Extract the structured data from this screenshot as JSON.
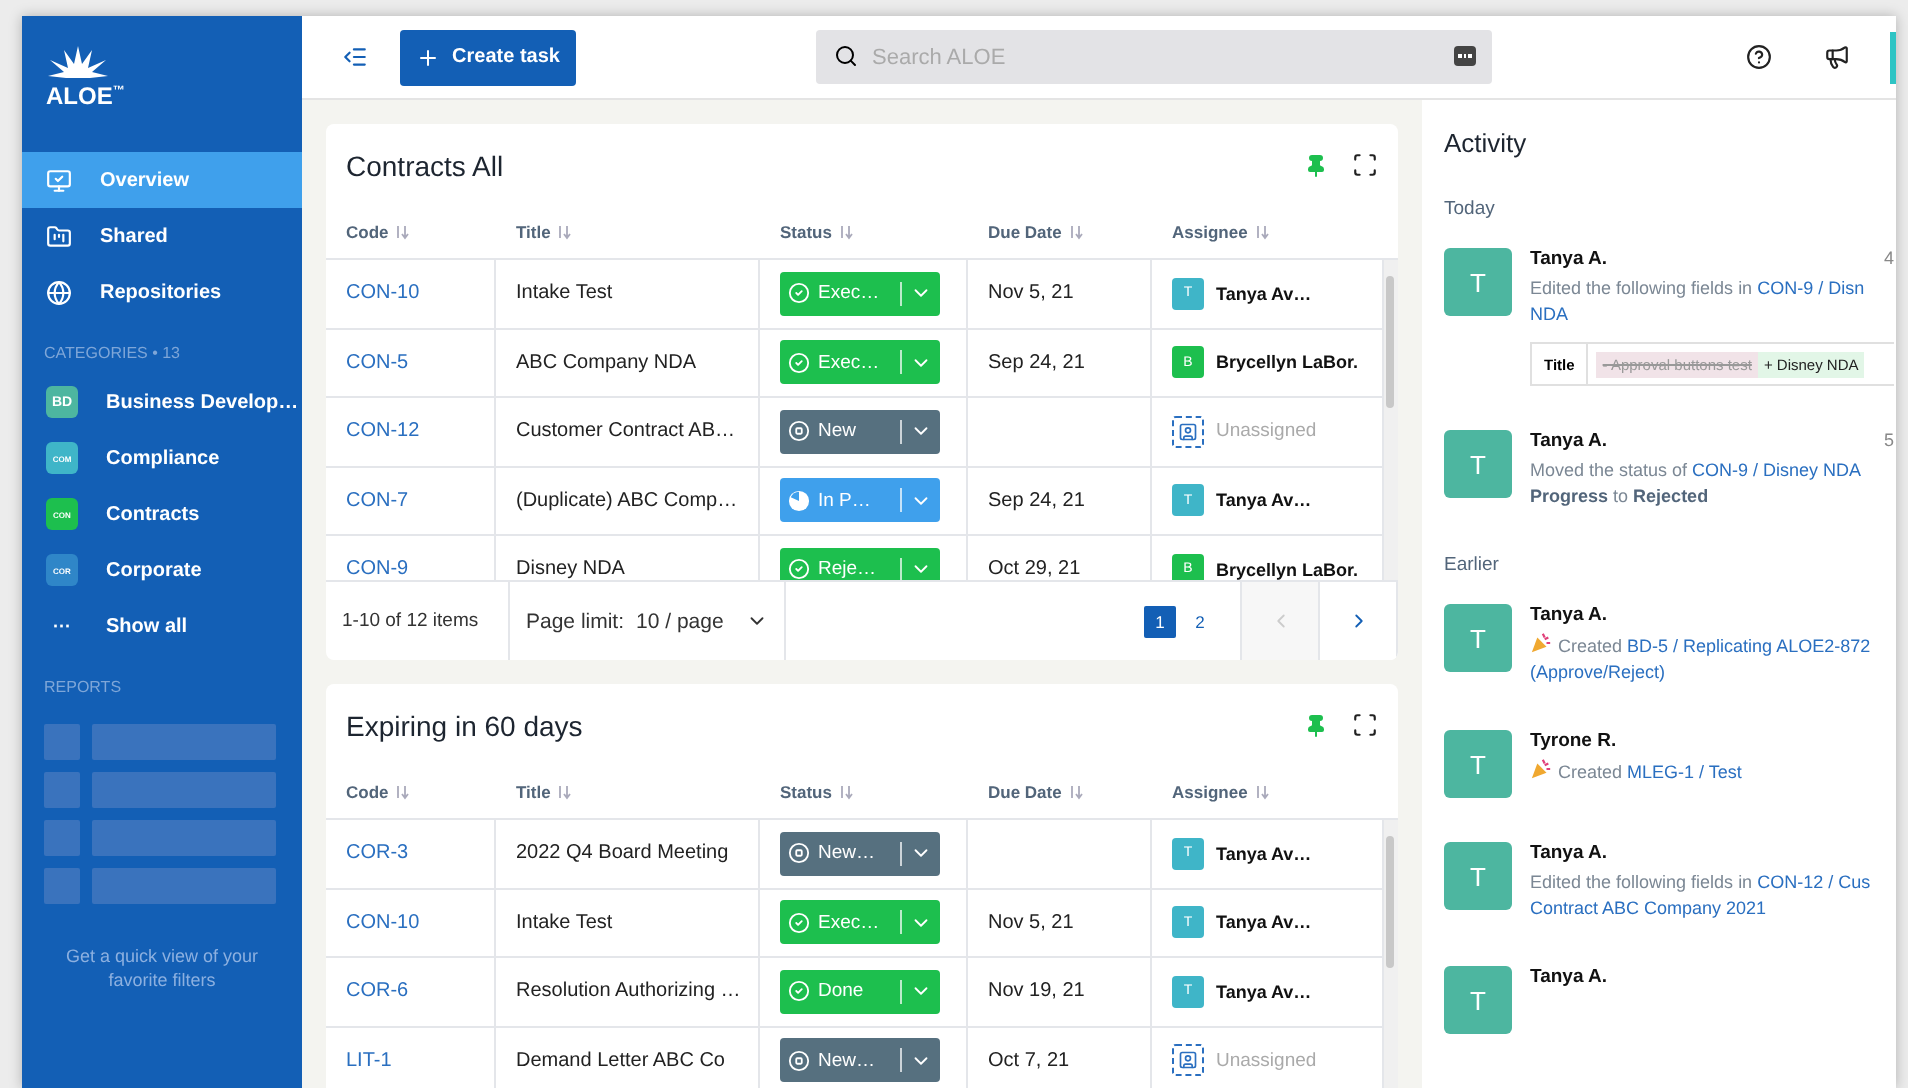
{
  "logo": {
    "text": "ALOE$^{™}$"
  },
  "sidebar": {
    "nav": [
      {
        "label": "Overview",
        "selected": true
      },
      {
        "label": "Shared",
        "selected": false
      },
      {
        "label": "Repositories",
        "selected": false
      }
    ],
    "categories_label": "CATEGORIES • 13",
    "categories": [
      {
        "badge": "BD",
        "label": "Business Develop…",
        "color": "#4db6a0"
      },
      {
        "badge": "COM",
        "label": "Compliance",
        "color": "#3fb5c8"
      },
      {
        "badge": "CON",
        "label": "Contracts",
        "color": "#1dbf4e"
      },
      {
        "badge": "COR",
        "label": "Corporate",
        "color": "#2f86c8"
      }
    ],
    "show_all": {
      "icon": "···",
      "label": "Show all"
    },
    "reports_label": "REPORTS",
    "reports_hint": "Get a quick view of your favorite filters"
  },
  "topbar": {
    "create_button": "Create task",
    "search": {
      "placeholder": "Search ALOE"
    }
  },
  "cards": [
    {
      "title": "Contracts All",
      "pinned": true,
      "columns": [
        "Code",
        "Title",
        "Status",
        "Due Date",
        "Assignee"
      ],
      "rows": [
        {
          "code": "CON-10",
          "title": "Intake Test",
          "status": {
            "label": "Exec…",
            "kind": "done"
          },
          "due": "Nov 5, 21",
          "assignee": {
            "kind": "person",
            "initial": "T",
            "name": "Tanya Av…",
            "color": "#3fb5c8"
          }
        },
        {
          "code": "CON-5",
          "title": "ABC Company NDA",
          "status": {
            "label": "Exec…",
            "kind": "done"
          },
          "due": "Sep 24, 21",
          "assignee": {
            "kind": "person",
            "initial": "B",
            "name": "Brycellyn LaBor.",
            "color": "#1dbf4e"
          }
        },
        {
          "code": "CON-12",
          "title": "Customer Contract AB…",
          "status": {
            "label": "New",
            "kind": "new"
          },
          "assignee": {
            "kind": "unassigned",
            "name": "Unassigned"
          }
        },
        {
          "code": "CON-7",
          "title": "(Duplicate) ABC Comp…",
          "status": {
            "label": "In P…",
            "kind": "progress"
          },
          "due": "Sep 24, 21",
          "assignee": {
            "kind": "person",
            "initial": "T",
            "name": "Tanya Av…",
            "color": "#3fb5c8"
          }
        },
        {
          "code": "CON-9",
          "title": "Disney NDA",
          "status": {
            "label": "Reje…",
            "kind": "done"
          },
          "due": "Oct 29, 21",
          "assignee": {
            "kind": "person",
            "initial": "B",
            "name": "Brycellyn LaBor.",
            "color": "#1dbf4e"
          }
        }
      ],
      "footer": {
        "count": "1-10 of 12 items",
        "page_limit_label": "Page limit:",
        "page_limit": "10 / page",
        "pages": [
          {
            "label": "1",
            "selected": true
          },
          {
            "label": "2",
            "selected": false
          }
        ]
      }
    },
    {
      "title": "Expiring in 60 days",
      "pinned": true,
      "columns": [
        "Code",
        "Title",
        "Status",
        "Due Date",
        "Assignee"
      ],
      "rows": [
        {
          "code": "COR-3",
          "title": "2022 Q4 Board Meeting",
          "status": {
            "label": "New…",
            "kind": "new"
          },
          "assignee": {
            "kind": "person",
            "initial": "T",
            "name": "Tanya Av…",
            "color": "#3fb5c8"
          }
        },
        {
          "code": "CON-10",
          "title": "Intake Test",
          "status": {
            "label": "Exec…",
            "kind": "done"
          },
          "due": "Nov 5, 21",
          "assignee": {
            "kind": "person",
            "initial": "T",
            "name": "Tanya Av…",
            "color": "#3fb5c8"
          }
        },
        {
          "code": "COR-6",
          "title": "Resolution Authorizing …",
          "status": {
            "label": "Done",
            "kind": "done"
          },
          "due": "Nov 19, 21",
          "assignee": {
            "kind": "person",
            "initial": "T",
            "name": "Tanya Av…",
            "color": "#3fb5c8"
          }
        },
        {
          "code": "LIT-1",
          "title": "Demand Letter ABC Co",
          "status": {
            "label": "New…",
            "kind": "new"
          },
          "due": "Oct 7, 21",
          "assignee": {
            "kind": "unassigned",
            "name": "Unassigned"
          }
        }
      ]
    }
  ],
  "activity": {
    "title": "Activity",
    "groups": [
      {
        "label": "Today",
        "entries": [
          {
            "initial": "T",
            "name": "Tanya A.",
            "time": "4",
            "created": false,
            "lines": [
              [
                {
                  "text": "Edited the following fields in ",
                  "kind": "plain"
                },
                {
                  "text": "CON-9 / Disn",
                  "kind": "link"
                }
              ],
              [
                {
                  "text": "NDA",
                  "kind": "link"
                }
              ]
            ],
            "diff": {
              "field": "Title",
              "removed": "- Approval buttons test",
              "added": "+ Disney NDA"
            }
          },
          {
            "initial": "T",
            "name": "Tanya A.",
            "time": "5",
            "created": false,
            "lines": [
              [
                {
                  "text": "Moved the status of ",
                  "kind": "plain"
                },
                {
                  "text": "CON-9 / Disney NDA",
                  "kind": "link"
                }
              ],
              [
                {
                  "text": "Progress",
                  "kind": "strong"
                },
                {
                  "text": " to ",
                  "kind": "plain"
                },
                {
                  "text": "Rejected",
                  "kind": "strong"
                }
              ]
            ]
          }
        ]
      },
      {
        "label": "Earlier",
        "entries": [
          {
            "initial": "T",
            "name": "Tanya A.",
            "created": true,
            "lines": [
              [
                {
                  "text": "Created ",
                  "kind": "plain"
                },
                {
                  "text": "BD-5 / Replicating ALOE2-872",
                  "kind": "link"
                }
              ],
              [
                {
                  "text": "(Approve/Reject)",
                  "kind": "link"
                }
              ]
            ]
          },
          {
            "initial": "T",
            "name": "Tyrone R.",
            "created": true,
            "lines": [
              [
                {
                  "text": "Created ",
                  "kind": "plain"
                },
                {
                  "text": "MLEG-1 / Test",
                  "kind": "link"
                }
              ]
            ]
          },
          {
            "initial": "T",
            "name": "Tanya A.",
            "created": false,
            "lines": [
              [
                {
                  "text": "Edited the following fields in ",
                  "kind": "plain"
                },
                {
                  "text": "CON-12 / Cus",
                  "kind": "link"
                }
              ],
              [
                {
                  "text": "Contract ABC Company 2021",
                  "kind": "link"
                }
              ]
            ]
          },
          {
            "initial": "T",
            "name": "Tanya A."
          }
        ]
      }
    ]
  }
}
